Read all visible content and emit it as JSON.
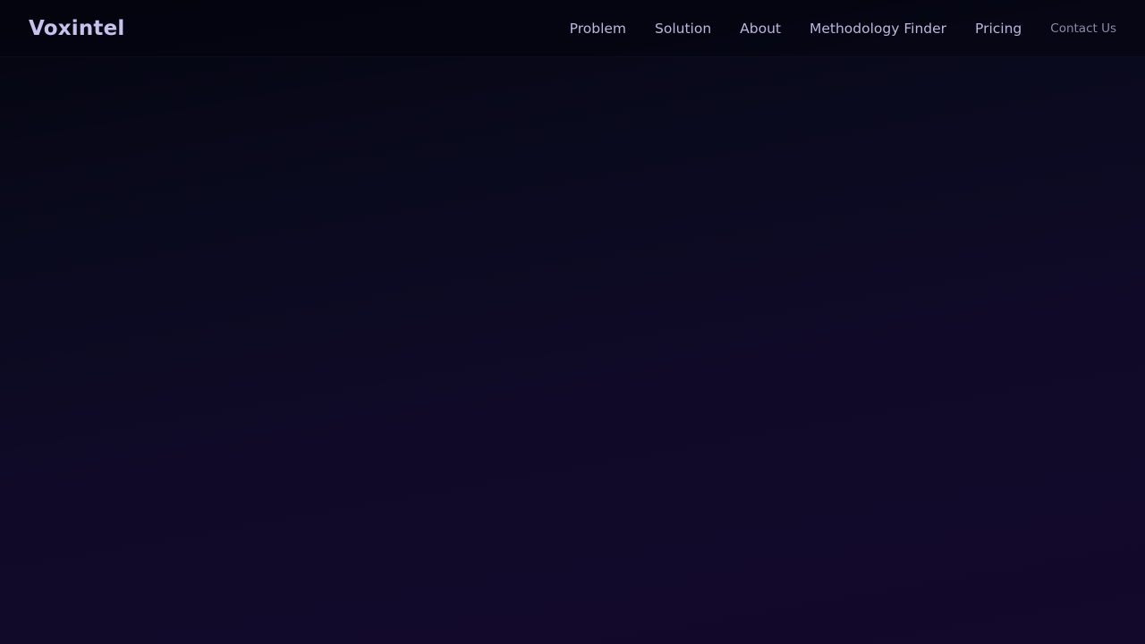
{
  "header": {
    "brand": "Voxintel",
    "nav": [
      {
        "label": "Problem"
      },
      {
        "label": "Solution"
      },
      {
        "label": "About"
      },
      {
        "label": "Methodology Finder"
      },
      {
        "label": "Pricing"
      }
    ],
    "contact_label": "Contact Us"
  },
  "colors": {
    "brand_text": "#c8c1ec",
    "nav_text": "#bcb6db",
    "contact_text": "#8d89a8",
    "background_top": "#04050f",
    "background_bottom": "#13092b"
  }
}
